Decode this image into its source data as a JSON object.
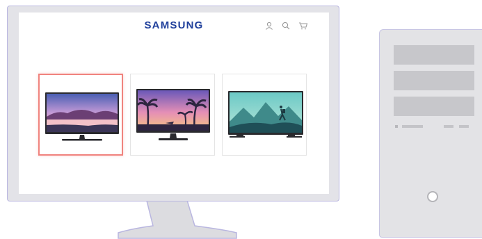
{
  "screen": {
    "brand_logo": "SAMSUNG"
  },
  "header_icons": [
    "user-icon",
    "search-icon",
    "cart-icon"
  ],
  "products": [
    {
      "name": "tv-lake-sunset",
      "selected": true
    },
    {
      "name": "tv-palm-sunset",
      "selected": false
    },
    {
      "name": "tv-mountain-hiker",
      "selected": false
    }
  ],
  "colors": {
    "brand": "#1f3f9b",
    "selection": "#f0837e",
    "bezel": "#e3e3e8",
    "outline": "#b9b6e0"
  }
}
